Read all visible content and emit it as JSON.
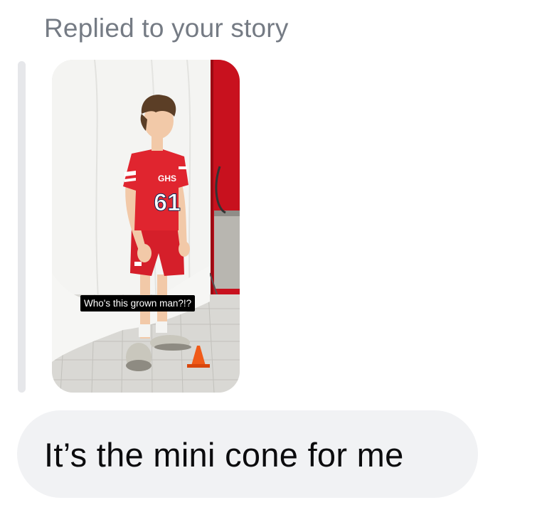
{
  "reply": {
    "label": "Replied to your story"
  },
  "story": {
    "caption": "Who's this grown man?!?",
    "jersey_text": "GHS",
    "jersey_number": "61",
    "colors": {
      "jersey": "#e0252f",
      "backdrop": "#f4f4f2",
      "wall": "#c8111e",
      "cone": "#f05a18"
    }
  },
  "message": {
    "text": "It’s the mini cone for me"
  },
  "colors": {
    "label": "#757b84",
    "bubble": "#f1f2f4",
    "quote_bar": "#e6e7ea",
    "text": "#0b0b0d"
  }
}
